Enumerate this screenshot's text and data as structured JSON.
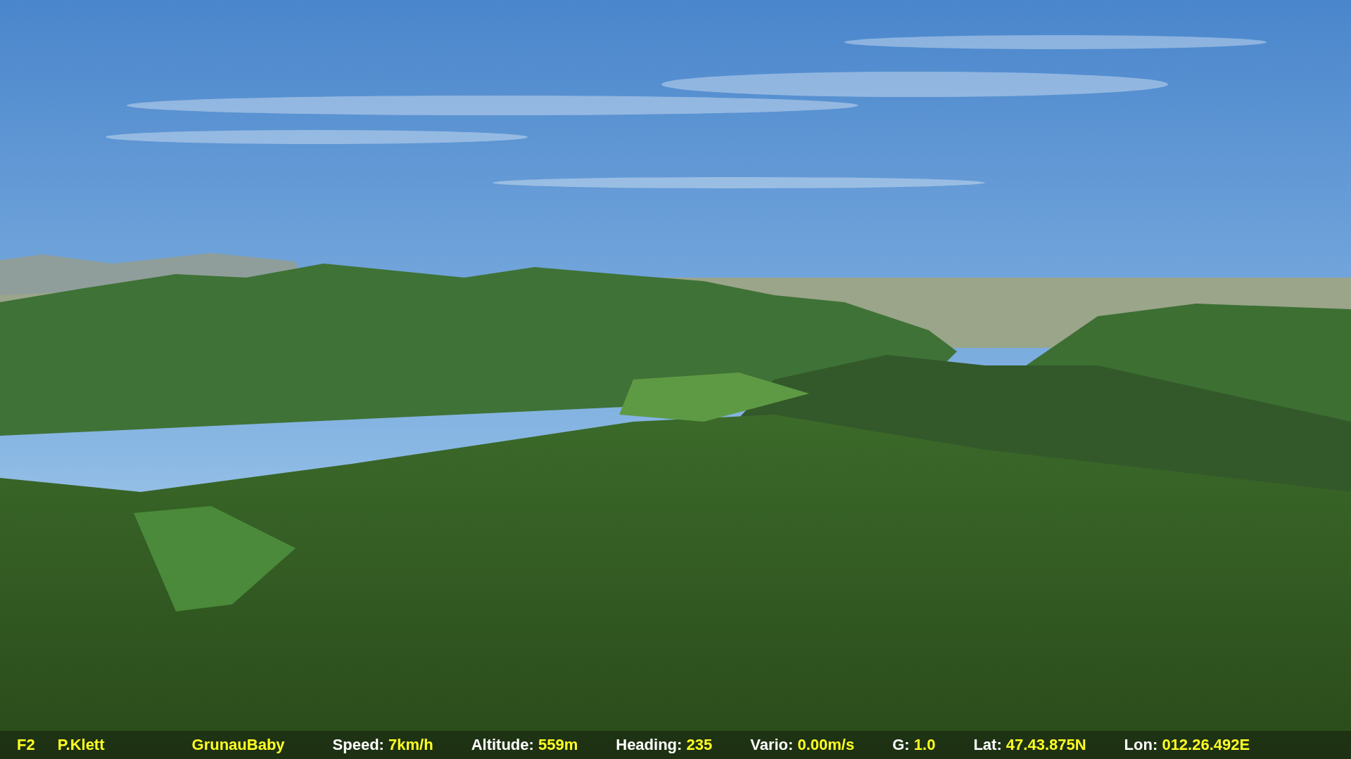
{
  "status_bar": {
    "view_key": "F2",
    "pilot": "P.Klett",
    "glider": "GrunauBaby",
    "readouts": [
      {
        "label": "Speed:",
        "value": "7km/h"
      },
      {
        "label": "Altitude:",
        "value": "559m"
      },
      {
        "label": "Heading:",
        "value": "235"
      },
      {
        "label": "Vario:",
        "value": "0.00m/s"
      },
      {
        "label": "G:",
        "value": "1.0"
      },
      {
        "label": "Lat:",
        "value": "47.43.875N"
      },
      {
        "label": "Lon:",
        "value": "012.26.492E"
      }
    ]
  }
}
